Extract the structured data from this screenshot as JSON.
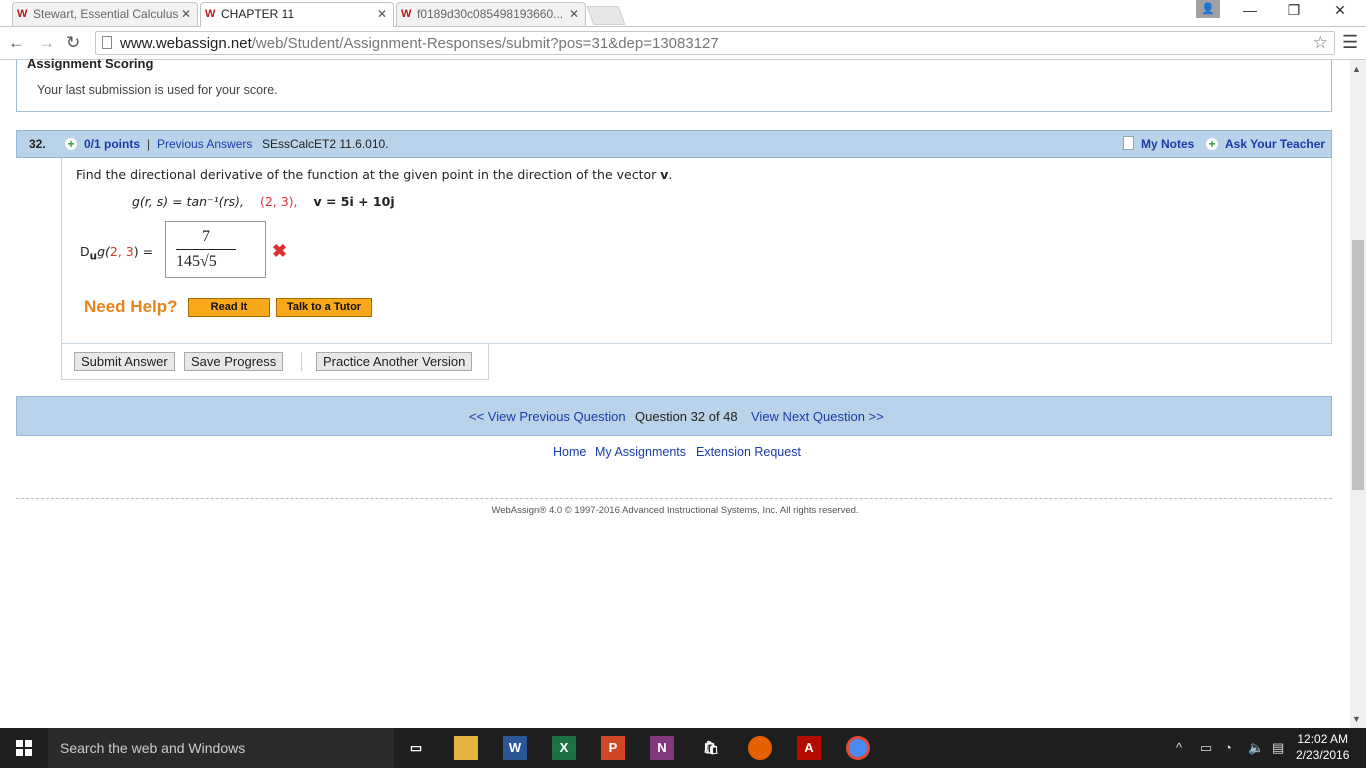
{
  "browser": {
    "tabs": [
      {
        "favicon": "W",
        "title": "Stewart, Essential Calculus"
      },
      {
        "favicon": "W",
        "title": "CHAPTER 11"
      },
      {
        "favicon": "W",
        "title": "f0189d30c085498193660..."
      }
    ],
    "url_host": "www.webassign.net",
    "url_path": "/web/Student/Assignment-Responses/submit?pos=31&dep=13083127"
  },
  "scoring": {
    "title": "Assignment Scoring",
    "text": "Your last submission is used for your score."
  },
  "question": {
    "number": "32.",
    "points": "0/1 points",
    "separator": "|",
    "previous_answers": "Previous Answers",
    "code": "SEssCalcET2 11.6.010.",
    "my_notes": "My Notes",
    "ask_teacher": "Ask Your Teacher",
    "prompt_before": "Find the directional derivative of the function at the given point in the direction of the vector ",
    "prompt_vector": "v",
    "prompt_after": ".",
    "function": "g(r, s) = tan⁻¹(rs),",
    "point": "(2, 3),",
    "vector": "v = 5i + 10j",
    "answer_label_prefix": "D",
    "answer_label_u": "u",
    "answer_label_g": "g(",
    "answer_point": "2, 3",
    "answer_label_end": ") =",
    "answer_numerator": "7",
    "answer_denominator": "145√5",
    "need_help": "Need Help?",
    "read_it": "Read It",
    "talk_tutor": "Talk to a Tutor",
    "submit": "Submit Answer",
    "save": "Save Progress",
    "practice": "Practice Another Version"
  },
  "navigation": {
    "prev": "<< View Previous Question",
    "position": "Question 32 of 48",
    "next": "View Next Question >>"
  },
  "footer": {
    "home": "Home",
    "my_assignments": "My Assignments",
    "extension": "Extension Request",
    "copyright": "WebAssign® 4.0 © 1997-2016 Advanced Instructional Systems, Inc. All rights reserved."
  },
  "taskbar": {
    "search": "Search the web and Windows",
    "time": "12:02 AM",
    "date": "2/23/2016"
  }
}
